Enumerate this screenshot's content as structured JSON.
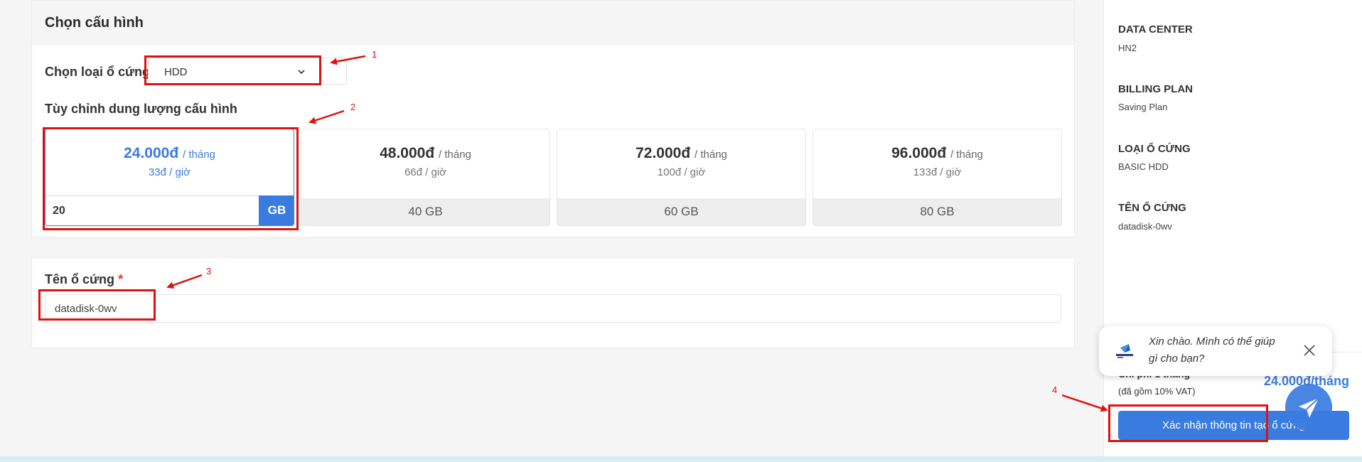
{
  "config": {
    "title": "Chọn cấu hình",
    "disk_type_label": "Chọn loại ổ cứng:",
    "disk_type_value": "HDD",
    "custom_label": "Tùy chỉnh dung lượng cấu hình",
    "plans": [
      {
        "price": "24.000đ",
        "per": "/ tháng",
        "hour": "33đ / giờ",
        "size": "20",
        "unit": "GB",
        "selected": true
      },
      {
        "price": "48.000đ",
        "per": "/ tháng",
        "hour": "66đ / giờ",
        "size": "40 GB"
      },
      {
        "price": "72.000đ",
        "per": "/ tháng",
        "hour": "100đ / giờ",
        "size": "60 GB"
      },
      {
        "price": "96.000đ",
        "per": "/ tháng",
        "hour": "133đ / giờ",
        "size": "80 GB"
      }
    ]
  },
  "name_card": {
    "label": "Tên ổ cứng",
    "required_mark": "*",
    "value": "datadisk-0wv"
  },
  "sidebar": {
    "items": [
      {
        "label": "DATA CENTER",
        "value": "HN2"
      },
      {
        "label": "BILLING PLAN",
        "value": "Saving Plan"
      },
      {
        "label": "LOẠI Ổ CỨNG",
        "value": "BASIC HDD"
      },
      {
        "label": "TÊN Ổ CỨNG",
        "value": "datadisk-0wv"
      }
    ],
    "price_title": "Chi phí 1 tháng",
    "total": "24.000đ/tháng",
    "vat_note": "(đã gồm 10% VAT)",
    "confirm_label": "Xác nhận thông tin tạo ổ cứng"
  },
  "chat": {
    "message": "Xin chào. Mình có thể giúp gì cho bạn?"
  },
  "annotations": [
    "1",
    "2",
    "3",
    "4"
  ],
  "colors": {
    "accent": "#3a7be0",
    "highlight": "#e01010"
  }
}
